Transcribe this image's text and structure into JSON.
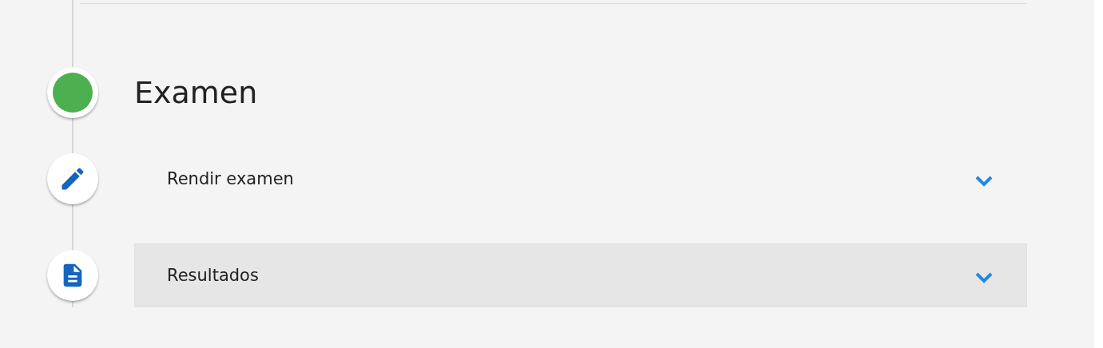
{
  "section": {
    "title": "Examen",
    "status": {
      "color": "#4caf50"
    }
  },
  "items": [
    {
      "label": "Rendir examen",
      "kind": "pencil",
      "selected": false,
      "expanded": false
    },
    {
      "label": "Resultados",
      "kind": "document",
      "selected": true,
      "expanded": false
    }
  ]
}
